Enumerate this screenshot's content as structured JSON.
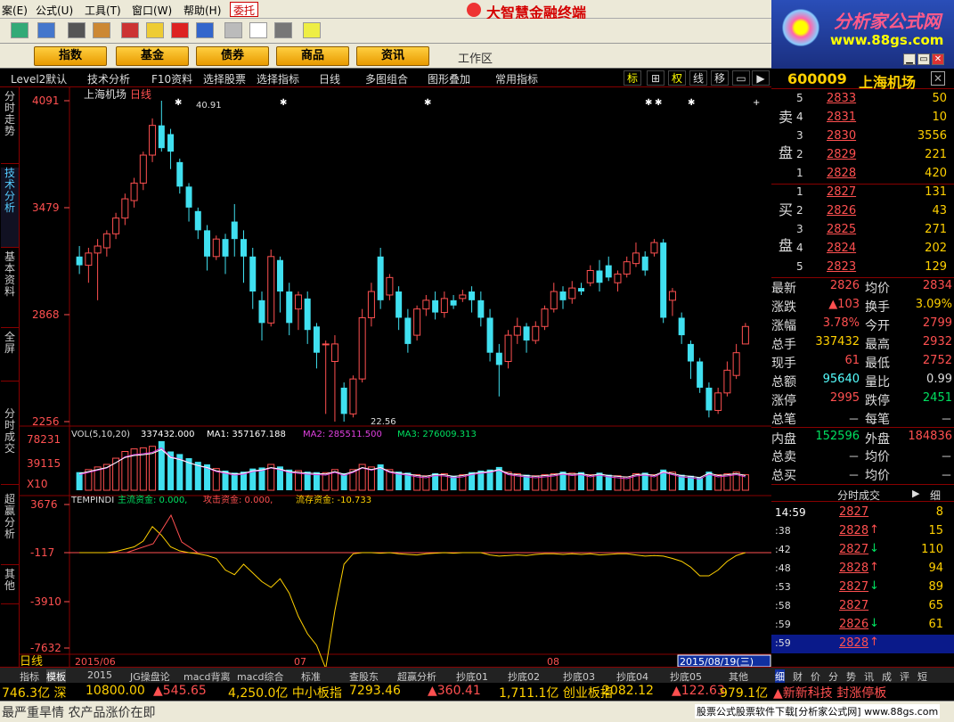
{
  "menu": {
    "items": [
      "案(E)",
      "公式(U)",
      "工具(T)",
      "窗口(W)",
      "帮助(H)"
    ],
    "trust": "委托"
  },
  "app_title": "大智慧金融终端",
  "brand": {
    "logo": "分析家公式网",
    "url": "www.88gs.com"
  },
  "nav": {
    "buttons": [
      "指数",
      "基金",
      "债券",
      "商品",
      "资讯"
    ],
    "workspace": "工作区"
  },
  "subbar": {
    "items": [
      "Level2默认",
      "技术分析",
      "F10资料",
      "选择股票",
      "选择指标",
      "日线",
      "多图组合",
      "图形叠加",
      "常用指标"
    ],
    "right": [
      "标",
      "⊞",
      "权",
      "线",
      "移",
      "▭",
      "▶"
    ]
  },
  "left_tabs": [
    "分时走势",
    "技术分析",
    "基本资料",
    "全屏",
    "分时成交",
    "超赢分析",
    "其他"
  ],
  "chart": {
    "title": "上海机场",
    "period": "日线",
    "price_axis": [
      "4091",
      "3479",
      "2868",
      "2256"
    ],
    "high_label": "40.91",
    "low_label": "22.56",
    "vol_title": "VOL(5,10,20)",
    "vol_val": "337432.000",
    "ma1": "MA1: 357167.188",
    "ma2": "MA2: 285511.500",
    "ma3": "MA3: 276009.313",
    "vol_axis": [
      "78231",
      "39115",
      "X10"
    ],
    "ind_title": "TEMPINDI",
    "ind_main": "主流资金: 0.000,",
    "ind_attack": "攻击资金: 0.000,",
    "ind_stock": "流存资金: -10.733",
    "ind_axis": [
      "3676",
      "-117",
      "-3910",
      "-7632"
    ],
    "x_labels": [
      "2015/06",
      "07",
      "08"
    ],
    "cursor_date": "2015/08/19(三)",
    "period_bottom": "日线"
  },
  "stock": {
    "code": "600009",
    "name": "上海机场"
  },
  "orderbook": {
    "sell_label": "卖盘",
    "buy_label": "买盘",
    "sell": [
      {
        "i": "5",
        "p": "2833",
        "v": "50"
      },
      {
        "i": "4",
        "p": "2831",
        "v": "10"
      },
      {
        "i": "3",
        "p": "2830",
        "v": "3556"
      },
      {
        "i": "2",
        "p": "2829",
        "v": "221"
      },
      {
        "i": "1",
        "p": "2828",
        "v": "420"
      }
    ],
    "buy": [
      {
        "i": "1",
        "p": "2827",
        "v": "131"
      },
      {
        "i": "2",
        "p": "2826",
        "v": "43"
      },
      {
        "i": "3",
        "p": "2825",
        "v": "271"
      },
      {
        "i": "4",
        "p": "2824",
        "v": "202"
      },
      {
        "i": "5",
        "p": "2823",
        "v": "129"
      }
    ]
  },
  "quote": [
    {
      "a": "最新",
      "b": "2826",
      "bc": "#ff5050",
      "c": "均价",
      "d": "2834",
      "dc": "#ff5050"
    },
    {
      "a": "涨跌",
      "b": "▲103",
      "bc": "#ff5050",
      "c": "换手",
      "d": "3.09%",
      "dc": "#ffd000"
    },
    {
      "a": "涨幅",
      "b": "3.78%",
      "bc": "#ff5050",
      "c": "今开",
      "d": "2799",
      "dc": "#ff5050"
    },
    {
      "a": "总手",
      "b": "337432",
      "bc": "#ffd000",
      "c": "最高",
      "d": "2932",
      "dc": "#ff5050"
    },
    {
      "a": "现手",
      "b": "61",
      "bc": "#ff5050",
      "c": "最低",
      "d": "2752",
      "dc": "#ff5050"
    },
    {
      "a": "总额",
      "b": "95640",
      "bc": "#5ff",
      "c": "量比",
      "d": "0.99",
      "dc": "#ddd"
    },
    {
      "a": "涨停",
      "b": "2995",
      "bc": "#ff5050",
      "c": "跌停",
      "d": "2451",
      "dc": "#00e060"
    },
    {
      "a": "总笔",
      "b": "－",
      "bc": "#ddd",
      "c": "每笔",
      "d": "－",
      "dc": "#ddd"
    },
    {
      "a": "内盘",
      "b": "152596",
      "bc": "#00e060",
      "c": "外盘",
      "d": "184836",
      "dc": "#ff5050"
    },
    {
      "a": "总卖",
      "b": "－",
      "bc": "#ddd",
      "c": "均价",
      "d": "－",
      "dc": "#ddd"
    },
    {
      "a": "总买",
      "b": "－",
      "bc": "#ddd",
      "c": "均价",
      "d": "－",
      "dc": "#ddd"
    }
  ],
  "ticks_title": "分时成交",
  "ticks_btn": "细",
  "ticks": [
    {
      "t": "14:59",
      "p": "2827",
      "arr": "",
      "v": "8"
    },
    {
      "t": ":38",
      "p": "2828",
      "arr": "↑",
      "v": "15"
    },
    {
      "t": ":42",
      "p": "2827",
      "arr": "↓",
      "v": "110"
    },
    {
      "t": ":48",
      "p": "2828",
      "arr": "↑",
      "v": "94"
    },
    {
      "t": ":53",
      "p": "2827",
      "arr": "↓",
      "v": "89"
    },
    {
      "t": ":58",
      "p": "2827",
      "arr": "",
      "v": "65"
    },
    {
      "t": ":59",
      "p": "2826",
      "arr": "↓",
      "v": "61"
    },
    {
      "t": ":59",
      "p": "2828",
      "arr": "↑",
      "v": ""
    }
  ],
  "bottom_tabs": [
    "指标",
    "模板",
    "2015",
    "JG操盘论",
    "macd背离",
    "macd综合",
    "标准",
    "查股东",
    "超赢分析",
    "抄底01",
    "抄底02",
    "抄底03",
    "抄底04",
    "抄底05",
    "其他"
  ],
  "right_tabs": [
    "细",
    "财",
    "价",
    "分",
    "势",
    "讯",
    "成",
    "评",
    "短"
  ],
  "ticker": [
    {
      "t": "746.3亿 深",
      "c": "#ffd000"
    },
    {
      "t": "10800.00",
      "c": "#ffd000"
    },
    {
      "t": "▲545.65",
      "c": "#ff5050"
    },
    {
      "t": "4,250.0亿 中小板指",
      "c": "#ffd000"
    },
    {
      "t": "7293.46",
      "c": "#ffd000"
    },
    {
      "t": "▲360.41",
      "c": "#ff5050"
    },
    {
      "t": "1,711.1亿 创业板指",
      "c": "#ffd000"
    },
    {
      "t": "2082.12",
      "c": "#ffd000"
    },
    {
      "t": "▲122.63",
      "c": "#ff5050"
    },
    {
      "t": "979.1亿",
      "c": "#ffd000"
    },
    {
      "t": "▲新新科技 封涨停板",
      "c": "#ff5050"
    }
  ],
  "status": {
    "msg": "最严重旱情 农产品涨价在即",
    "download": "股票公式股票软件下载[分析家公式网] www.88gs.com"
  },
  "colors": {
    "up": "#ff5050",
    "down": "#40e0f0",
    "bg": "#000000"
  }
}
